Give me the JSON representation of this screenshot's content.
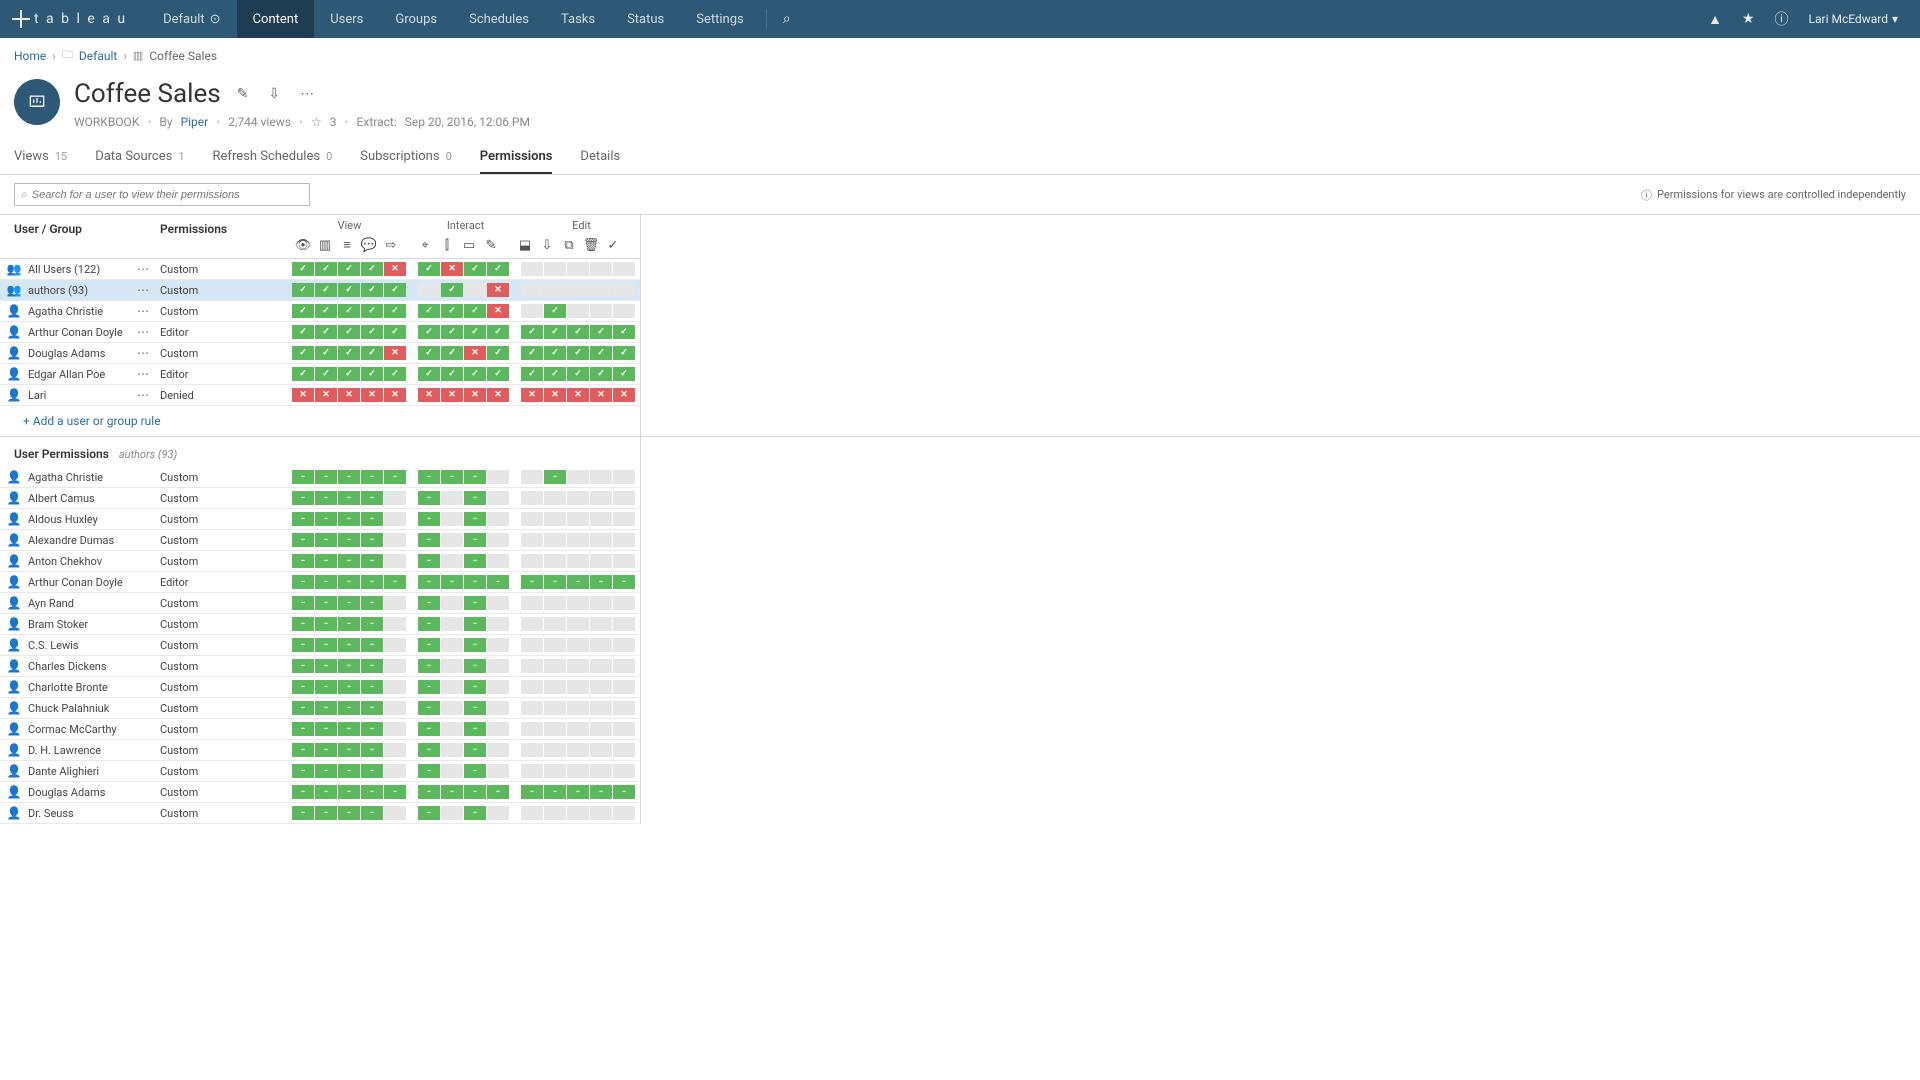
{
  "nav": {
    "logo_text": "t a b l e a u",
    "site_selector": "Default",
    "items": [
      "Content",
      "Users",
      "Groups",
      "Schedules",
      "Tasks",
      "Status",
      "Settings"
    ],
    "active_index": 0,
    "user": "Lari McEdward"
  },
  "breadcrumb": {
    "home": "Home",
    "project": "Default",
    "item": "Coffee Sales"
  },
  "workbook": {
    "title": "Coffee Sales",
    "type_label": "WORKBOOK",
    "by_label": "By",
    "author": "Piper",
    "views": "2,744 views",
    "fav_count": "3",
    "extract_label": "Extract:",
    "extract_time": "Sep 20, 2016, 12:06 PM"
  },
  "tabs": [
    {
      "label": "Views",
      "count": "15"
    },
    {
      "label": "Data Sources",
      "count": "1"
    },
    {
      "label": "Refresh Schedules",
      "count": "0"
    },
    {
      "label": "Subscriptions",
      "count": "0"
    },
    {
      "label": "Permissions",
      "count": ""
    },
    {
      "label": "Details",
      "count": ""
    }
  ],
  "active_tab": 4,
  "search_placeholder": "Search for a user to view their permissions",
  "info_note": "Permissions for views are controlled independently",
  "columns": {
    "user_group": "User / Group",
    "permissions": "Permissions",
    "groups": [
      "View",
      "Interact",
      "Edit"
    ]
  },
  "cap_group_sizes": [
    5,
    4,
    5
  ],
  "rules": [
    {
      "icon": "group",
      "name": "All Users (122)",
      "perm": "Custom",
      "caps": [
        [
          "a",
          "a",
          "a",
          "a",
          "d"
        ],
        [
          "a",
          "d",
          "a",
          "a"
        ],
        [
          "n",
          "n",
          "n",
          "n",
          "n"
        ]
      ]
    },
    {
      "icon": "group",
      "name": "authors (93)",
      "perm": "Custom",
      "selected": true,
      "caps": [
        [
          "a",
          "a",
          "a",
          "a",
          "a"
        ],
        [
          "n",
          "a",
          "n",
          "d"
        ],
        [
          "n",
          "n",
          "n",
          "n",
          "n"
        ]
      ]
    },
    {
      "icon": "user",
      "name": "Agatha Christie",
      "perm": "Custom",
      "caps": [
        [
          "a",
          "a",
          "a",
          "a",
          "a"
        ],
        [
          "a",
          "a",
          "a",
          "d"
        ],
        [
          "n",
          "a",
          "n",
          "n",
          "n"
        ]
      ]
    },
    {
      "icon": "user",
      "name": "Arthur Conan Doyle",
      "perm": "Editor",
      "caps": [
        [
          "a",
          "a",
          "a",
          "a",
          "a"
        ],
        [
          "a",
          "a",
          "a",
          "a"
        ],
        [
          "a",
          "a",
          "a",
          "a",
          "a"
        ]
      ]
    },
    {
      "icon": "user",
      "name": "Douglas Adams",
      "perm": "Custom",
      "caps": [
        [
          "a",
          "a",
          "a",
          "a",
          "d"
        ],
        [
          "a",
          "a",
          "d",
          "a"
        ],
        [
          "a",
          "a",
          "a",
          "a",
          "a"
        ]
      ]
    },
    {
      "icon": "user",
      "name": "Edgar Allan Poe",
      "perm": "Editor",
      "caps": [
        [
          "a",
          "a",
          "a",
          "a",
          "a"
        ],
        [
          "a",
          "a",
          "a",
          "a"
        ],
        [
          "a",
          "a",
          "a",
          "a",
          "a"
        ]
      ]
    },
    {
      "icon": "user",
      "name": "Lari",
      "perm": "Denied",
      "caps": [
        [
          "d",
          "d",
          "d",
          "d",
          "d"
        ],
        [
          "d",
          "d",
          "d",
          "d"
        ],
        [
          "d",
          "d",
          "d",
          "d",
          "d"
        ]
      ]
    }
  ],
  "add_rule_label": "+ Add a user or group rule",
  "user_perms_header": {
    "title": "User Permissions",
    "sub": "authors (93)"
  },
  "user_rows": [
    {
      "name": "Agatha Christie",
      "perm": "Custom",
      "caps": [
        [
          "a",
          "a",
          "a",
          "a",
          "a"
        ],
        [
          "a",
          "a",
          "a",
          "n"
        ],
        [
          "n",
          "a",
          "n",
          "n",
          "n"
        ]
      ]
    },
    {
      "name": "Albert Camus",
      "perm": "Custom",
      "caps": [
        [
          "a",
          "a",
          "a",
          "a",
          "n"
        ],
        [
          "a",
          "n",
          "a",
          "n"
        ],
        [
          "n",
          "n",
          "n",
          "n",
          "n"
        ]
      ]
    },
    {
      "name": "Aldous Huxley",
      "perm": "Custom",
      "caps": [
        [
          "a",
          "a",
          "a",
          "a",
          "n"
        ],
        [
          "a",
          "n",
          "a",
          "n"
        ],
        [
          "n",
          "n",
          "n",
          "n",
          "n"
        ]
      ]
    },
    {
      "name": "Alexandre Dumas",
      "perm": "Custom",
      "caps": [
        [
          "a",
          "a",
          "a",
          "a",
          "n"
        ],
        [
          "a",
          "n",
          "a",
          "n"
        ],
        [
          "n",
          "n",
          "n",
          "n",
          "n"
        ]
      ]
    },
    {
      "name": "Anton Chekhov",
      "perm": "Custom",
      "caps": [
        [
          "a",
          "a",
          "a",
          "a",
          "n"
        ],
        [
          "a",
          "n",
          "a",
          "n"
        ],
        [
          "n",
          "n",
          "n",
          "n",
          "n"
        ]
      ]
    },
    {
      "name": "Arthur Conan Doyle",
      "perm": "Editor",
      "caps": [
        [
          "a",
          "a",
          "a",
          "a",
          "a"
        ],
        [
          "a",
          "a",
          "a",
          "a"
        ],
        [
          "a",
          "a",
          "a",
          "a",
          "a"
        ]
      ]
    },
    {
      "name": "Ayn Rand",
      "perm": "Custom",
      "caps": [
        [
          "a",
          "a",
          "a",
          "a",
          "n"
        ],
        [
          "a",
          "n",
          "a",
          "n"
        ],
        [
          "n",
          "n",
          "n",
          "n",
          "n"
        ]
      ]
    },
    {
      "name": "Bram Stoker",
      "perm": "Custom",
      "caps": [
        [
          "a",
          "a",
          "a",
          "a",
          "n"
        ],
        [
          "a",
          "n",
          "a",
          "n"
        ],
        [
          "n",
          "n",
          "n",
          "n",
          "n"
        ]
      ]
    },
    {
      "name": "C.S. Lewis",
      "perm": "Custom",
      "caps": [
        [
          "a",
          "a",
          "a",
          "a",
          "n"
        ],
        [
          "a",
          "n",
          "a",
          "n"
        ],
        [
          "n",
          "n",
          "n",
          "n",
          "n"
        ]
      ]
    },
    {
      "name": "Charles Dickens",
      "perm": "Custom",
      "caps": [
        [
          "a",
          "a",
          "a",
          "a",
          "n"
        ],
        [
          "a",
          "n",
          "a",
          "n"
        ],
        [
          "n",
          "n",
          "n",
          "n",
          "n"
        ]
      ]
    },
    {
      "name": "Charlotte Bronte",
      "perm": "Custom",
      "caps": [
        [
          "a",
          "a",
          "a",
          "a",
          "n"
        ],
        [
          "a",
          "n",
          "a",
          "n"
        ],
        [
          "n",
          "n",
          "n",
          "n",
          "n"
        ]
      ]
    },
    {
      "name": "Chuck Palahniuk",
      "perm": "Custom",
      "caps": [
        [
          "a",
          "a",
          "a",
          "a",
          "n"
        ],
        [
          "a",
          "n",
          "a",
          "n"
        ],
        [
          "n",
          "n",
          "n",
          "n",
          "n"
        ]
      ]
    },
    {
      "name": "Cormac McCarthy",
      "perm": "Custom",
      "caps": [
        [
          "a",
          "a",
          "a",
          "a",
          "n"
        ],
        [
          "a",
          "n",
          "a",
          "n"
        ],
        [
          "n",
          "n",
          "n",
          "n",
          "n"
        ]
      ]
    },
    {
      "name": "D. H. Lawrence",
      "perm": "Custom",
      "caps": [
        [
          "a",
          "a",
          "a",
          "a",
          "n"
        ],
        [
          "a",
          "n",
          "a",
          "n"
        ],
        [
          "n",
          "n",
          "n",
          "n",
          "n"
        ]
      ]
    },
    {
      "name": "Dante Alighieri",
      "perm": "Custom",
      "caps": [
        [
          "a",
          "a",
          "a",
          "a",
          "n"
        ],
        [
          "a",
          "n",
          "a",
          "n"
        ],
        [
          "n",
          "n",
          "n",
          "n",
          "n"
        ]
      ]
    },
    {
      "name": "Douglas Adams",
      "perm": "Custom",
      "caps": [
        [
          "a",
          "a",
          "a",
          "a",
          "a"
        ],
        [
          "a",
          "a",
          "a",
          "a"
        ],
        [
          "a",
          "a",
          "a",
          "a",
          "a"
        ]
      ]
    },
    {
      "name": "Dr. Seuss",
      "perm": "Custom",
      "caps": [
        [
          "a",
          "a",
          "a",
          "a",
          "n"
        ],
        [
          "a",
          "n",
          "a",
          "n"
        ],
        [
          "n",
          "n",
          "n",
          "n",
          "n"
        ]
      ]
    }
  ]
}
